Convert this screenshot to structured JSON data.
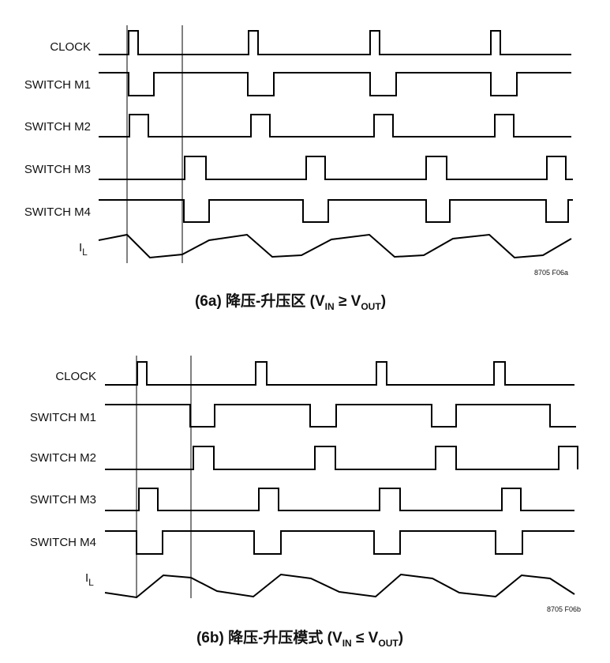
{
  "panel_a": {
    "signals": [
      "CLOCK",
      "SWITCH M1",
      "SWITCH M2",
      "SWITCH M3",
      "SWITCH M4"
    ],
    "current_label": "I",
    "current_subscript": "L",
    "figure_code": "8705 F06a",
    "caption": {
      "prefix": "(6a) 降压-升压区 (V",
      "sub1": "IN",
      "middle": " ≥ V",
      "sub2": "OUT",
      "suffix": ")"
    }
  },
  "panel_b": {
    "signals": [
      "CLOCK",
      "SWITCH M1",
      "SWITCH M2",
      "SWITCH M3",
      "SWITCH M4"
    ],
    "current_label": "I",
    "current_subscript": "L",
    "figure_code": "8705 F06b",
    "caption": {
      "prefix": "(6b) 降压-升压模式 (V",
      "sub1": "IN",
      "middle": " ≤ V",
      "sub2": "OUT",
      "suffix": ")"
    }
  }
}
